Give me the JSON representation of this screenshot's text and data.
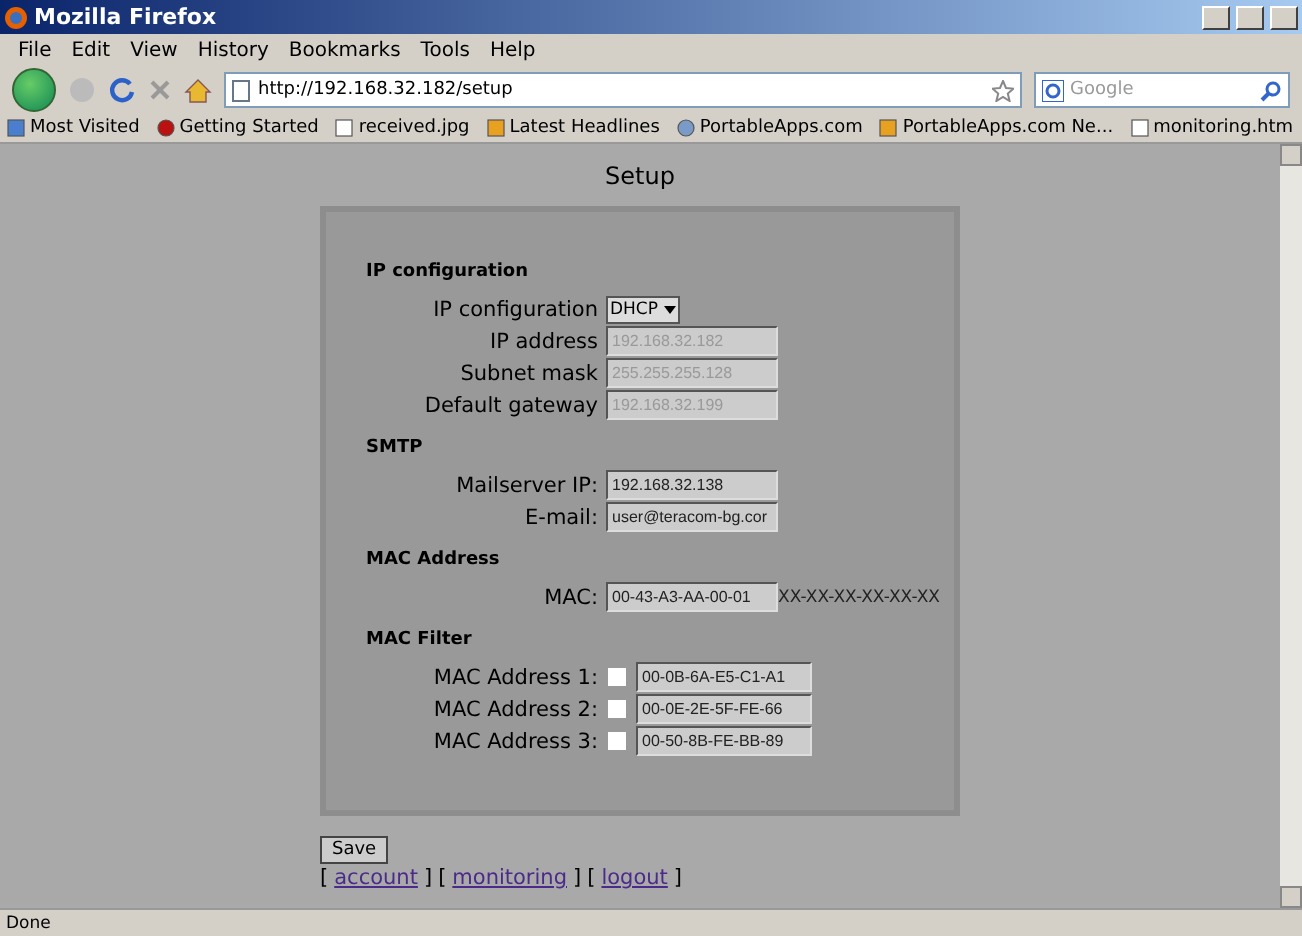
{
  "window": {
    "title": "Mozilla Firefox"
  },
  "menu": [
    "File",
    "Edit",
    "View",
    "History",
    "Bookmarks",
    "Tools",
    "Help"
  ],
  "address_bar": {
    "value": "http://192.168.32.182/setup"
  },
  "search": {
    "placeholder": "Google"
  },
  "bookmarks": [
    {
      "label": "Most Visited",
      "kind": "folder-blue"
    },
    {
      "label": "Getting Started",
      "kind": "red"
    },
    {
      "label": "received.jpg",
      "kind": "page"
    },
    {
      "label": "Latest Headlines",
      "kind": "feed"
    },
    {
      "label": "PortableApps.com",
      "kind": "globe"
    },
    {
      "label": "PortableApps.com Ne...",
      "kind": "feed"
    },
    {
      "label": "monitoring.htm",
      "kind": "page"
    }
  ],
  "page": {
    "title": "Setup",
    "sections": [
      {
        "heading": "IP configuration",
        "rows": [
          {
            "label": "IP configuration",
            "kind": "select",
            "value": "DHCP"
          },
          {
            "label": "IP address",
            "kind": "input",
            "value": "192.168.32.182",
            "disabled": true
          },
          {
            "label": "Subnet mask",
            "kind": "input",
            "value": "255.255.255.128",
            "disabled": true
          },
          {
            "label": "Default gateway",
            "kind": "input",
            "value": "192.168.32.199",
            "disabled": true
          }
        ]
      },
      {
        "heading": "SMTP",
        "rows": [
          {
            "label": "Mailserver IP:",
            "kind": "input",
            "value": "192.168.32.138",
            "disabled": false
          },
          {
            "label": "E-mail:",
            "kind": "input",
            "value": "user@teracom-bg.cor",
            "disabled": false
          }
        ]
      },
      {
        "heading": "MAC Address",
        "rows": [
          {
            "label": "MAC:",
            "kind": "input",
            "value": "00-43-A3-AA-00-01",
            "disabled": false,
            "hint": "XX-XX-XX-XX-XX-XX"
          }
        ]
      },
      {
        "heading": "MAC Filter",
        "rows": [
          {
            "label": "MAC Address 1:",
            "kind": "check-input",
            "checked": false,
            "value": "00-0B-6A-E5-C1-A1"
          },
          {
            "label": "MAC Address 2:",
            "kind": "check-input",
            "checked": false,
            "value": "00-0E-2E-5F-FE-66"
          },
          {
            "label": "MAC Address 3:",
            "kind": "check-input",
            "checked": false,
            "value": "00-50-8B-FE-BB-89"
          }
        ]
      }
    ],
    "save_button": "Save",
    "links": [
      {
        "open": "[",
        "label": "account",
        "close": "]"
      },
      {
        "open": "[",
        "label": "monitoring",
        "close": "]"
      },
      {
        "open": "[",
        "label": "logout",
        "close": "]"
      }
    ]
  },
  "status_bar": "Done"
}
